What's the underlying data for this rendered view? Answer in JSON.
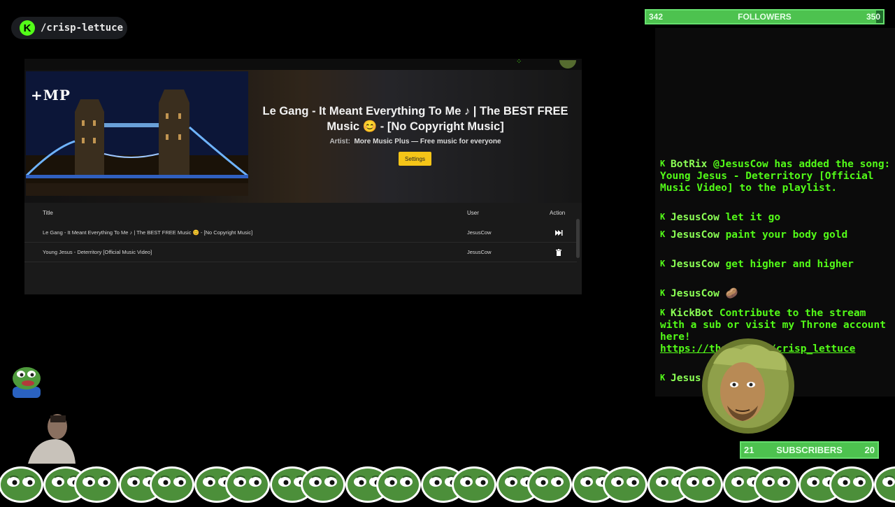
{
  "channel": {
    "name": "/crisp-lettuce",
    "logo_letter": "K"
  },
  "player": {
    "logo": "+MP",
    "song_title": "Le Gang - It Meant Everything To Me ♪ | The BEST FREE Music 😊 - [No Copyright Music]",
    "artist_label": "Artist:",
    "artist_value": "More Music Plus — Free music for everyone",
    "settings_label": "Settings",
    "table": {
      "headers": {
        "title": "Title",
        "user": "User",
        "action": "Action"
      },
      "rows": [
        {
          "title": "Le Gang - It Meant Everything To Me ♪ | The BEST FREE Music 😊 - [No Copyright Music]",
          "user": "JesusCow",
          "action_icon": "skip-icon"
        },
        {
          "title": "Young Jesus - Deterritory [Official Music Video]",
          "user": "JesusCow",
          "action_icon": "trash-icon"
        }
      ]
    }
  },
  "followers": {
    "current": "342",
    "label": "FOLLOWERS",
    "goal": "350"
  },
  "subscribers": {
    "current": "21",
    "label": "SUBSCRIBERS",
    "goal": "20"
  },
  "chat": [
    {
      "user": "BotRix",
      "text": "@JesusCow has added the song: Young Jesus - Deterritory [Official Music Video] to the playlist."
    },
    {
      "user": "JesusCow",
      "text": "let it go"
    },
    {
      "user": "JesusCow",
      "text": "paint your body gold"
    },
    {
      "user": "JesusCow",
      "text": "get higher and higher"
    },
    {
      "user": "JesusCow",
      "text": ""
    },
    {
      "user": "KickBot",
      "text": "Contribute to the stream with a sub or visit my Throne account here! ",
      "link": "https://throne.com/crisp_lettuce"
    },
    {
      "user": "Jesus",
      "text": ""
    }
  ],
  "colors": {
    "kick_green": "#53fc18",
    "goal_bar": "#4dc24f",
    "settings_button": "#f5c518"
  }
}
